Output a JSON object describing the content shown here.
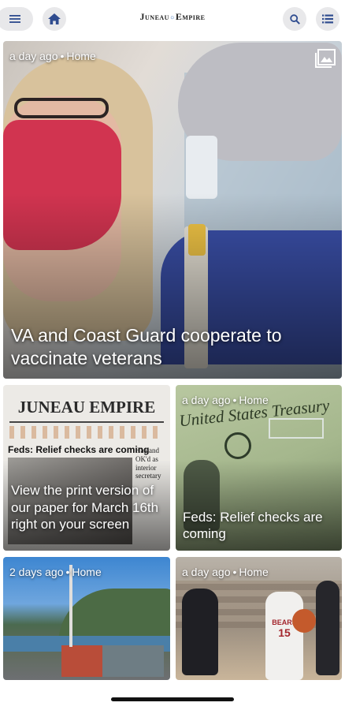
{
  "header": {
    "logo_text": "Juneau",
    "logo_mark": "☼",
    "logo_text2": "Empire",
    "icons": {
      "menu": "hamburger-menu-icon",
      "home": "home-icon",
      "search": "search-icon",
      "list": "list-icon"
    }
  },
  "cards": [
    {
      "meta_time": "a day ago",
      "meta_section": "Home",
      "headline": "VA and Coast Guard cooperate to vaccinate veterans",
      "gallery_icon": "image-gallery-icon"
    },
    {
      "meta_time": "",
      "meta_section": "",
      "headline": "View the print version of our paper for March 16th right on your screen",
      "print_masthead": "JUNEAU EMPIRE",
      "print_headline": "Feds: Relief checks are coming",
      "print_sidebar": "Haaland OK'd as interior secretary"
    },
    {
      "meta_time": "a day ago",
      "meta_section": "Home",
      "headline": "Feds: Relief checks are coming",
      "check_text": "United States Treasury"
    },
    {
      "meta_time": "2 days ago",
      "meta_section": "Home",
      "headline": ""
    },
    {
      "meta_time": "a day ago",
      "meta_section": "Home",
      "headline": "",
      "jersey_text": "BEARS",
      "jersey_number": "15"
    }
  ]
}
